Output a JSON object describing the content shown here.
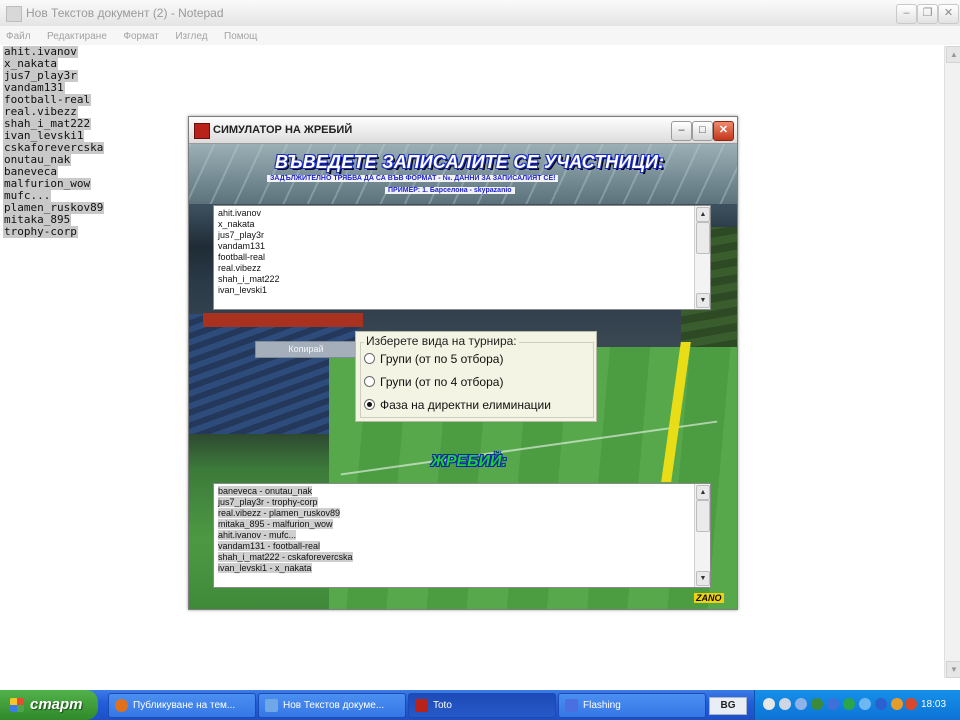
{
  "notepad": {
    "title": "Нов Текстов документ (2) - Notepad",
    "menu": [
      "Файл",
      "Редактиране",
      "Формат",
      "Изглед",
      "Помощ"
    ],
    "lines": [
      "ahit.ivanov",
      "x_nakata",
      "jus7_play3r",
      "vandam131",
      "football-real",
      "real.vibezz",
      "shah_i_mat222",
      "ivan_levski1",
      "cskaforevercska",
      "onutau_nak",
      "baneveca",
      "malfurion_wow",
      "mufc...",
      "plamen_ruskov89",
      "mitaka_895",
      "trophy-corp"
    ]
  },
  "simulator": {
    "title": "СИМУЛАТОР НА ЖРЕБИЙ",
    "banner_title": "ВЪВЕДЕТЕ ЗАПИСАЛИТЕ СЕ УЧАСТНИЦИ:",
    "banner_note1": "ЗАДЪЛЖИТЕЛНО ТРЯБВА ДА СА ВЪВ ФОРМАТ - №. ДАННИ ЗА ЗАПИСАЛИЯТ СЕ!",
    "banner_note2": "ПРИМЕР: 1. Барселона - skypazanio",
    "participants": [
      "ahit.ivanov",
      "x_nakata",
      "jus7_play3r",
      "vandam131",
      "football-real",
      "real.vibezz",
      "shah_i_mat222",
      "ivan_levski1"
    ],
    "copy_button": "Копирай",
    "tournament": {
      "legend": "Изберете вида на турнира:",
      "options": [
        "Групи (от по 5 отбора)",
        "Групи (от по 4 отбора)",
        "Фаза на директни елиминации"
      ],
      "selected_index": 2
    },
    "draw_heading": "ЖРЕБИЙ:",
    "draw_results": [
      "baneveca - onutau_nak",
      "jus7_play3r - trophy-corp",
      "real.vibezz - plamen_ruskov89",
      "mitaka_895 - malfurion_wow",
      "ahit.ivanov - mufc...",
      "vandam131 - football-real",
      "shah_i_mat222 - cskaforevercska",
      "ivan_levski1 - x_nakata"
    ],
    "brand": "ZANO"
  },
  "taskbar": {
    "start": "старт",
    "tasks": [
      {
        "label": "Публикуване на тем...",
        "icon_color": "#e0701c"
      },
      {
        "label": "Нов Текстов докуме...",
        "icon_color": "#6fa7e8"
      },
      {
        "label": "Toto",
        "icon_color": "#b8221a"
      },
      {
        "label": "Flashing",
        "icon_color": "#4a6fe0"
      }
    ],
    "language": "BG",
    "clock": "18:03"
  }
}
